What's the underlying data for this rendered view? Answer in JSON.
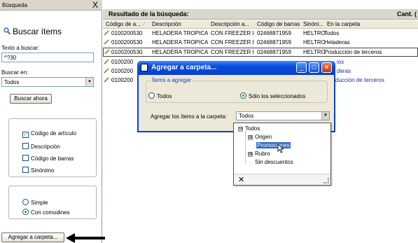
{
  "left_panel": {
    "header_title": "Búsqueda",
    "close_glyph": "X",
    "search_title": "Buscar ítems",
    "text_label": "Texto a buscar:",
    "text_value": "^?30",
    "search_in_label": "Buscar en:",
    "search_in_value": "Todos",
    "search_button": "Buscar ahora",
    "checkboxes": [
      {
        "label": "Código de artículo",
        "checked": true
      },
      {
        "label": "Descripción",
        "checked": false
      },
      {
        "label": "Código de barras",
        "checked": false
      },
      {
        "label": "Sinónimo",
        "checked": false
      }
    ],
    "mode_options": [
      {
        "label": "Simple",
        "selected": false
      },
      {
        "label": "Con comodines",
        "selected": true
      }
    ],
    "add_button": "Agregar a carpeta..."
  },
  "results": {
    "title": "Resultado de la búsqueda:",
    "count_label": "Cant. (",
    "columns": [
      "Código de a...",
      "Descripción",
      "Descripción a...",
      "Código de barras",
      "Sinóni...",
      "En la carpeta"
    ],
    "rows": [
      {
        "code": "0100200530",
        "desc": "HELADERA TROPICA",
        "desc2": "CON FREEZER I",
        "barcode": "02468871959",
        "syn": "HELTRO",
        "folder": "Todos"
      },
      {
        "code": "0100200530",
        "desc": "HELADERA TROPICA",
        "desc2": "CON FREEZER I",
        "barcode": "02468871959",
        "syn": "HELTRO",
        "folder": "Heladeras"
      },
      {
        "code": "0100200530",
        "desc": "HELADERA TROPICA",
        "desc2": "CON FREEZER I",
        "barcode": "02468871959",
        "syn": "HELTRO",
        "folder": "Producción de terceros"
      },
      {
        "code": "0100200",
        "folder": "ios"
      },
      {
        "code": "0100200",
        "folder": "deras"
      },
      {
        "code": "0100200",
        "folder": "ducción de terceros"
      }
    ]
  },
  "dialog": {
    "title": "Agregar a carpeta...",
    "group_label": "Ítems a agregar",
    "option_all": "Todos",
    "option_selected": "Sólo los seleccionados",
    "add_label": "Agregar los ítems a la carpeta:",
    "folder_value": "Todos",
    "buttons": {
      "minimize": "_",
      "maximize": "□",
      "close": "✕"
    }
  },
  "tree": {
    "root": "Todos",
    "items": [
      "Origen",
      "Promociones",
      "Rubro",
      "Sin descuentos"
    ],
    "expanders": [
      "⊟",
      "⊞",
      "⊞"
    ],
    "close_glyph": "✕"
  },
  "colors": {
    "titlebar": "#0a4ad8",
    "highlight": "#316ac5",
    "panel_header": "#d9d6cc",
    "link_blue": "#1a2f9a"
  }
}
